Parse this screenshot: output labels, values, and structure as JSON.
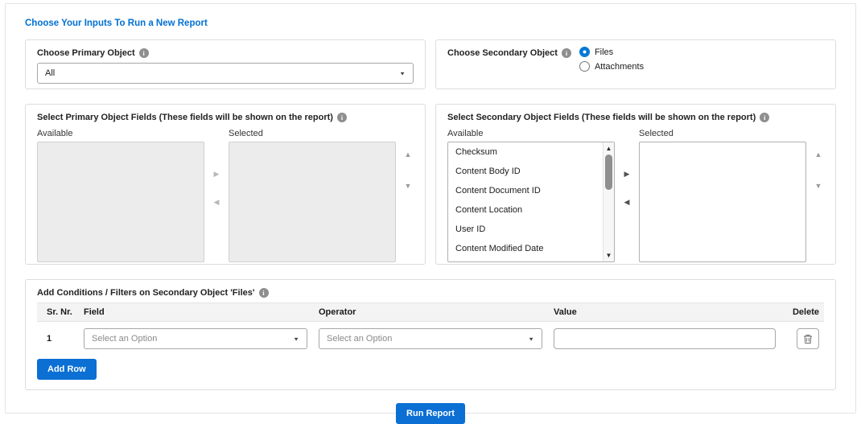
{
  "page": {
    "title": "Choose Your Inputs To Run a New Report"
  },
  "icons": {
    "info": "i",
    "chevron_down": "▼",
    "arrow_right": "▶",
    "arrow_left": "◀",
    "arrow_up": "▲",
    "arrow_down": "▼",
    "scroll_up": "▲",
    "scroll_down": "▼"
  },
  "primary_object": {
    "label": "Choose Primary Object",
    "selected_value": "All"
  },
  "secondary_object": {
    "label": "Choose Secondary Object",
    "options": [
      {
        "label": "Files",
        "selected": true
      },
      {
        "label": "Attachments",
        "selected": false
      }
    ]
  },
  "primary_fields": {
    "label": "Select Primary Object Fields (These fields will be shown on the report)",
    "available_label": "Available",
    "selected_label": "Selected",
    "available_items": [],
    "selected_items": []
  },
  "secondary_fields": {
    "label": "Select Secondary Object Fields (These fields will be shown on the report)",
    "available_label": "Available",
    "selected_label": "Selected",
    "available_items": [
      "Checksum",
      "Content Body ID",
      "Content Document ID",
      "Content Location",
      "User ID",
      "Content Modified Date"
    ],
    "selected_items": []
  },
  "conditions": {
    "label": "Add Conditions / Filters on Secondary Object 'Files'",
    "columns": [
      "Sr. Nr.",
      "Field",
      "Operator",
      "Value",
      "Delete"
    ],
    "rows": [
      {
        "sr": "1",
        "field_placeholder": "Select an Option",
        "operator_placeholder": "Select an Option",
        "value": ""
      }
    ],
    "add_row_label": "Add Row"
  },
  "run_report_label": "Run Report",
  "colors": {
    "accent": "#0070d2",
    "button": "#0b6fd4"
  }
}
